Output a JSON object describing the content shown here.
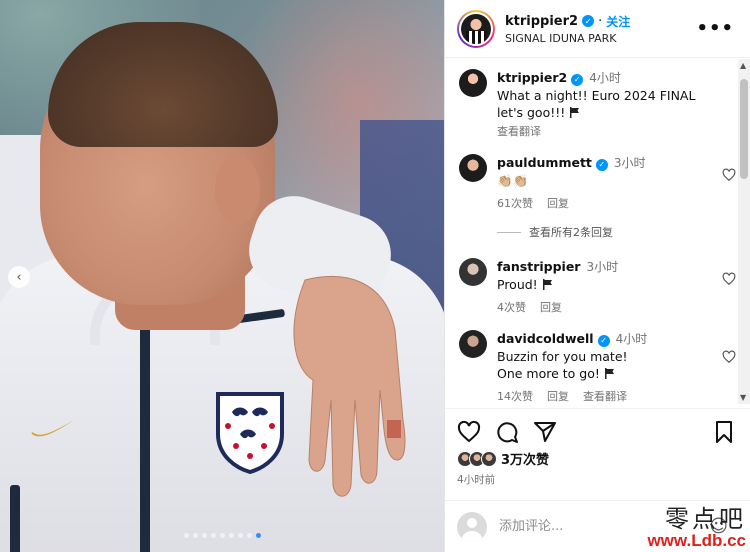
{
  "post": {
    "username": "ktrippier2",
    "follow_label": "关注",
    "location": "SIGNAL IDUNA PARK",
    "more_label": "•••",
    "carousel": {
      "total": 9,
      "active_index": 8
    }
  },
  "comments": [
    {
      "username": "ktrippier2",
      "verified": true,
      "time": "4小时",
      "text": "What a night!! Euro 2024 FINAL let's goo!!!",
      "trailing_emoji": "flag",
      "actions": [
        "查看翻译"
      ]
    },
    {
      "username": "pauldummett",
      "verified": true,
      "time": "3小时",
      "text": "👏🏼👏🏼",
      "likes": "61次赞",
      "reply": "回复",
      "view_replies": "查看所有2条回复"
    },
    {
      "username": "fanstrippier",
      "verified": false,
      "time": "3小时",
      "text": "Proud!",
      "trailing_emoji": "flag",
      "likes": "4次赞",
      "reply": "回复"
    },
    {
      "username": "davidcoldwell",
      "verified": true,
      "time": "4小时",
      "text": "Buzzin for you mate! One more to go!",
      "trailing_emoji": "flag",
      "likes": "14次赞",
      "reply": "回复",
      "translate": "查看翻译"
    }
  ],
  "engagement": {
    "likes_count": "3万次赞",
    "posted_ago": "4小时前"
  },
  "composer": {
    "placeholder": "添加评论..."
  },
  "watermark": {
    "line1": "零点吧",
    "line2": "www.Ldb.cc"
  },
  "colors": {
    "accent_blue": "#0095f6",
    "muted_text": "#737373",
    "watermark_red": "#e0201b"
  },
  "icons": [
    "heart-icon",
    "comment-icon",
    "share-icon",
    "bookmark-icon",
    "emoji-icon",
    "more-icon",
    "verified-badge-icon",
    "chevron-left-icon"
  ]
}
